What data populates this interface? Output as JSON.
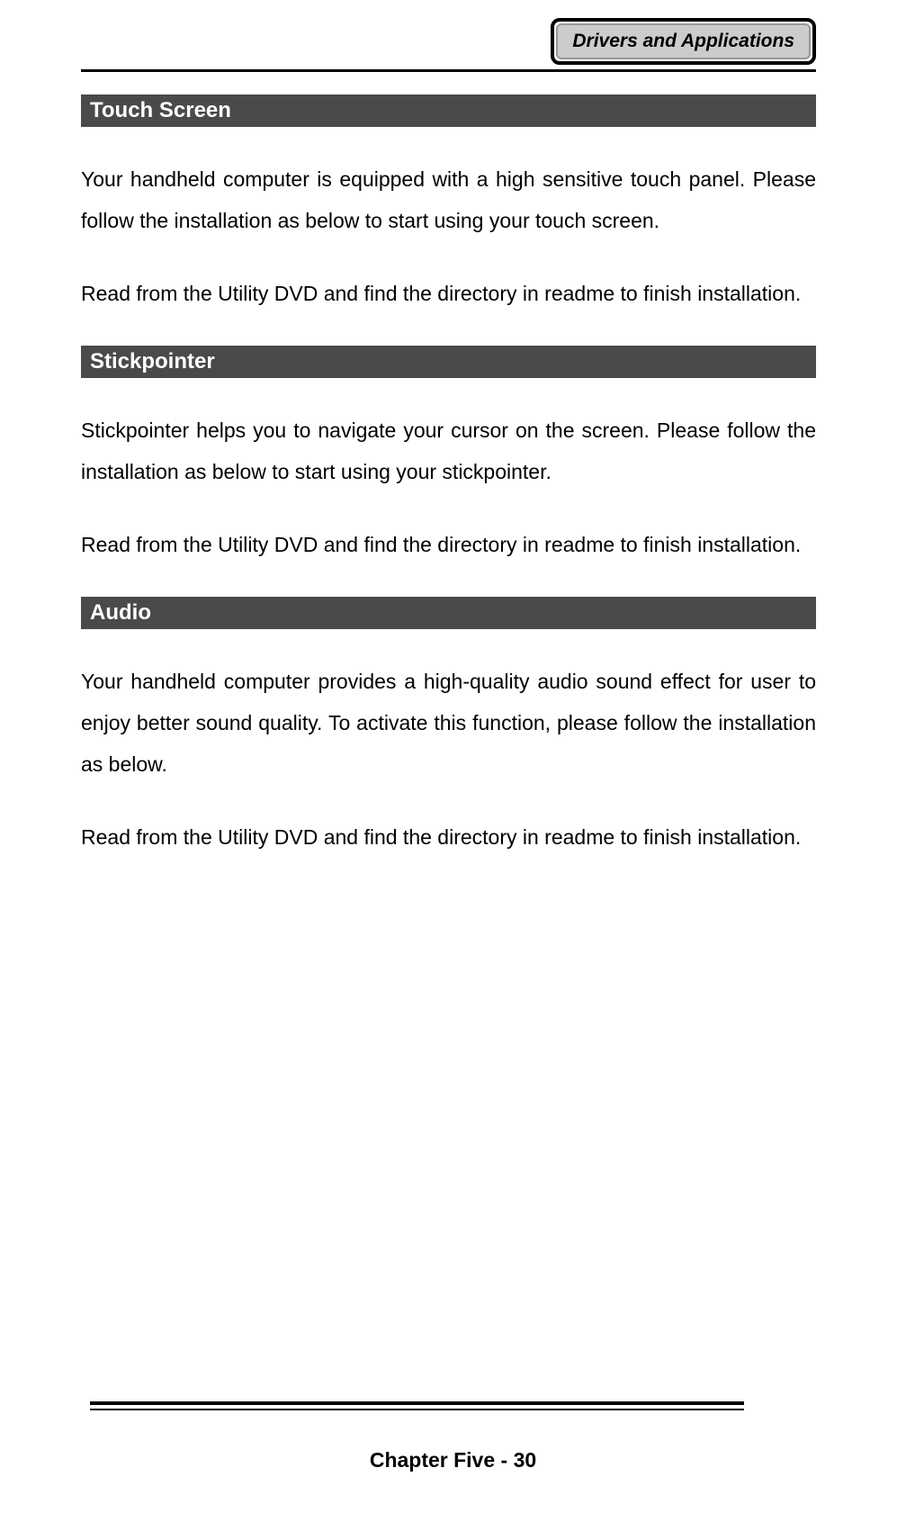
{
  "header": {
    "badge": "Drivers and Applications"
  },
  "sections": [
    {
      "heading": "Touch Screen",
      "paragraphs": [
        "Your handheld computer is equipped with a high sensitive touch panel. Please follow the installation as below to start using your touch screen.",
        "Read from the Utility DVD and find the directory in readme to finish installation."
      ]
    },
    {
      "heading": "Stickpointer",
      "paragraphs": [
        "Stickpointer helps you to navigate your cursor on the screen. Please follow the installation as below to start using your stickpointer.",
        "Read from the Utility DVD and find the directory in readme to finish installation."
      ]
    },
    {
      "heading": "Audio",
      "paragraphs": [
        "Your handheld computer provides a high-quality audio sound effect for user to enjoy better sound quality. To activate this function, please follow the installation as below.",
        "Read from the Utility DVD and find the directory in readme to finish installation."
      ]
    }
  ],
  "footer": {
    "text": "Chapter Five - 30"
  }
}
